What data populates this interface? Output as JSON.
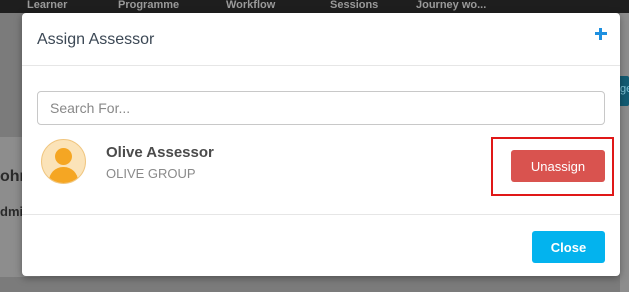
{
  "background": {
    "nav_tabs": [
      "Learner",
      "Programme",
      "Workflow",
      "Sessions",
      "Journey wo..."
    ],
    "left_fragment_name": "ohn",
    "left_fragment_label": "dmi",
    "right_fragment": "ge"
  },
  "modal": {
    "title": "Assign Assessor",
    "add_icon": "plus-icon",
    "search": {
      "placeholder": "Search For...",
      "value": ""
    },
    "assessor": {
      "name": "Olive Assessor",
      "group": "OLIVE GROUP",
      "avatar_icon": "user-avatar-icon"
    },
    "unassign_label": "Unassign",
    "close_label": "Close"
  },
  "colors": {
    "accent_blue": "#03b3ee",
    "danger_red": "#d9534f",
    "highlight_red": "#e01818",
    "avatar_orange": "#f5a623"
  }
}
